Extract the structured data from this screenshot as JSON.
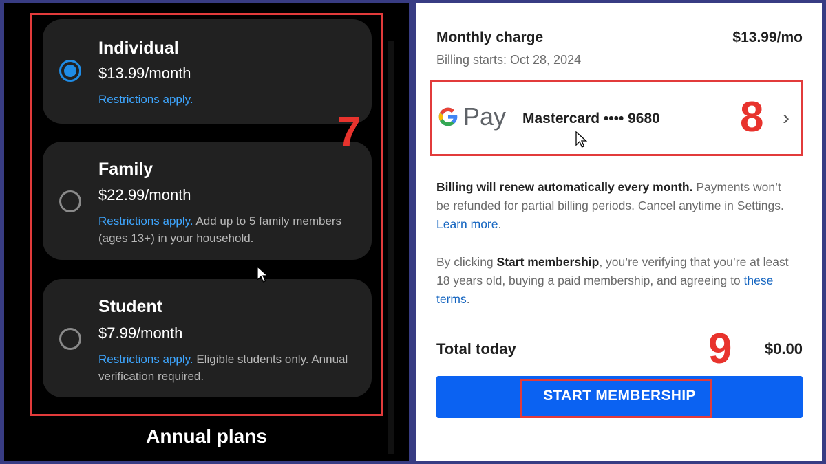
{
  "plans": {
    "items": [
      {
        "name": "Individual",
        "price": "$13.99/month",
        "restrictions": "Restrictions apply.",
        "note": "",
        "selected": true
      },
      {
        "name": "Family",
        "price": "$22.99/month",
        "restrictions": "Restrictions apply.",
        "note": " Add up to 5 family members (ages 13+) in your household.",
        "selected": false
      },
      {
        "name": "Student",
        "price": "$7.99/month",
        "restrictions": "Restrictions apply.",
        "note": " Eligible students only. Annual verification required.",
        "selected": false
      }
    ],
    "section_footer": "Annual plans"
  },
  "steps": {
    "step7": "7",
    "step8": "8",
    "step9": "9"
  },
  "checkout": {
    "monthly_charge_label": "Monthly charge",
    "monthly_charge_value": "$13.99/mo",
    "billing_start": "Billing starts: Oct 28, 2024",
    "payment": {
      "gpay_text": "Pay",
      "card": "Mastercard •••• 9680",
      "chevron": "›"
    },
    "renew_bold": "Billing will renew automatically every month.",
    "renew_text": " Payments won’t be refunded for partial billing periods. Cancel anytime in Settings. ",
    "learn_more": "Learn more",
    "renew_end": ".",
    "terms_pre": "By clicking ",
    "terms_bold": "Start membership",
    "terms_mid": ", you’re verifying that you’re at least 18 years old, buying a paid membership, and agreeing to ",
    "terms_link": "these terms",
    "terms_end": ".",
    "total_label": "Total today",
    "total_value": "$0.00",
    "start_button": "START MEMBERSHIP"
  },
  "colors": {
    "accent_blue": "#0b62f2",
    "highlight_red": "#e23b3b",
    "link_blue_dark": "#3ea6ff",
    "link_blue_light": "#1565c0"
  },
  "icons": [
    "radio-selected-icon",
    "radio-unselected-icon",
    "google-g-icon",
    "chevron-right-icon",
    "mouse-cursor-icon"
  ]
}
